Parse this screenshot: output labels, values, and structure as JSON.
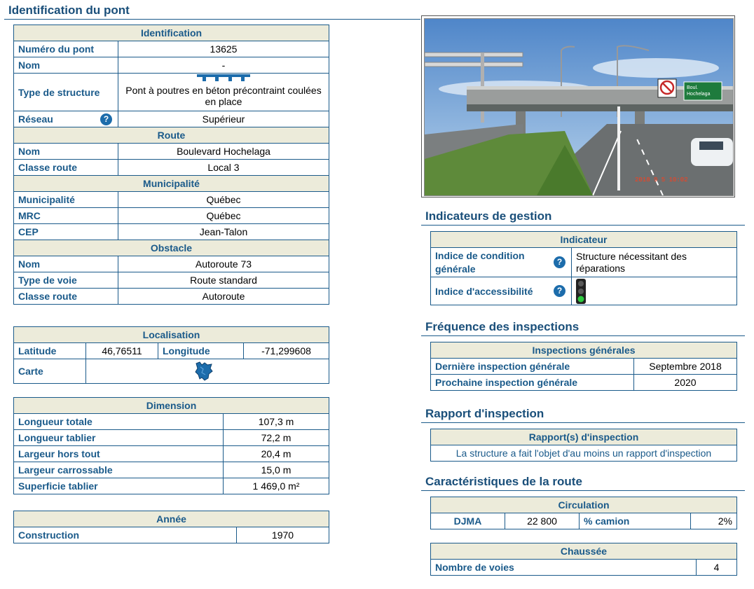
{
  "identification_title": "Identification du pont",
  "indicateurs_title": "Indicateurs de gestion",
  "frequence_title": "Fréquence des inspections",
  "rapport_title": "Rapport d'inspection",
  "caracteristiques_title": "Caractéristiques de la route",
  "ident": {
    "header": "Identification",
    "numero_label": "Numéro du pont",
    "numero": "13625",
    "nom_label": "Nom",
    "nom": "-",
    "type_label": "Type de structure",
    "type": "Pont à poutres en béton précontraint coulées en place",
    "reseau_label": "Réseau",
    "reseau": "Supérieur",
    "route_header": "Route",
    "route_nom_label": "Nom",
    "route_nom": "Boulevard Hochelaga",
    "classe_label": "Classe route",
    "classe": "Local 3",
    "muni_header": "Municipalité",
    "muni_label": "Municipalité",
    "muni": "Québec",
    "mrc_label": "MRC",
    "mrc": "Québec",
    "cep_label": "CEP",
    "cep": "Jean-Talon",
    "obstacle_header": "Obstacle",
    "obs_nom_label": "Nom",
    "obs_nom": "Autoroute 73",
    "voie_label": "Type de voie",
    "voie": "Route standard",
    "obs_classe_label": "Classe route",
    "obs_classe": "Autoroute"
  },
  "localisation": {
    "header": "Localisation",
    "lat_label": "Latitude",
    "lat": "46,76511",
    "lon_label": "Longitude",
    "lon": "-71,299608",
    "carte_label": "Carte"
  },
  "dimension": {
    "header": "Dimension",
    "rows": [
      {
        "label": "Longueur totale",
        "value": "107,3 m"
      },
      {
        "label": "Longueur tablier",
        "value": "72,2 m"
      },
      {
        "label": "Largeur hors tout",
        "value": "20,4 m"
      },
      {
        "label": "Largeur carrossable",
        "value": "15,0 m"
      },
      {
        "label": "Superficie tablier",
        "value": "1 469,0 m²"
      }
    ]
  },
  "annee": {
    "header": "Année",
    "construction_label": "Construction",
    "construction": "1970"
  },
  "photo": {
    "sign_text": "Boul. Hochelaga",
    "timestamp": "2018 9 5 10:02"
  },
  "indicateur": {
    "header": "Indicateur",
    "condition_label": "Indice de condition générale",
    "condition": "Structure nécessitant des réparations",
    "access_label": "Indice d'accessibilité",
    "access_level": "green"
  },
  "inspections": {
    "header": "Inspections générales",
    "derniere_label": "Dernière inspection générale",
    "derniere": "Septembre 2018",
    "prochaine_label": "Prochaine inspection générale",
    "prochaine": "2020"
  },
  "rapport": {
    "header": "Rapport(s) d'inspection",
    "text": "La structure a fait l'objet d'au moins un rapport d'inspection"
  },
  "circulation": {
    "header": "Circulation",
    "djma_label": "DJMA",
    "djma": "22 800",
    "camion_label": "% camion",
    "camion": "2%"
  },
  "chaussee": {
    "header": "Chaussée",
    "voies_label": "Nombre de voies",
    "voies": "4"
  },
  "icons": {
    "help": "question-icon",
    "map": "quebec-map-icon",
    "traffic": "traffic-light-icon"
  },
  "colors": {
    "accent": "#1a5a8a",
    "header_bg": "#ecebda",
    "help_icon": "#1c6cab"
  }
}
